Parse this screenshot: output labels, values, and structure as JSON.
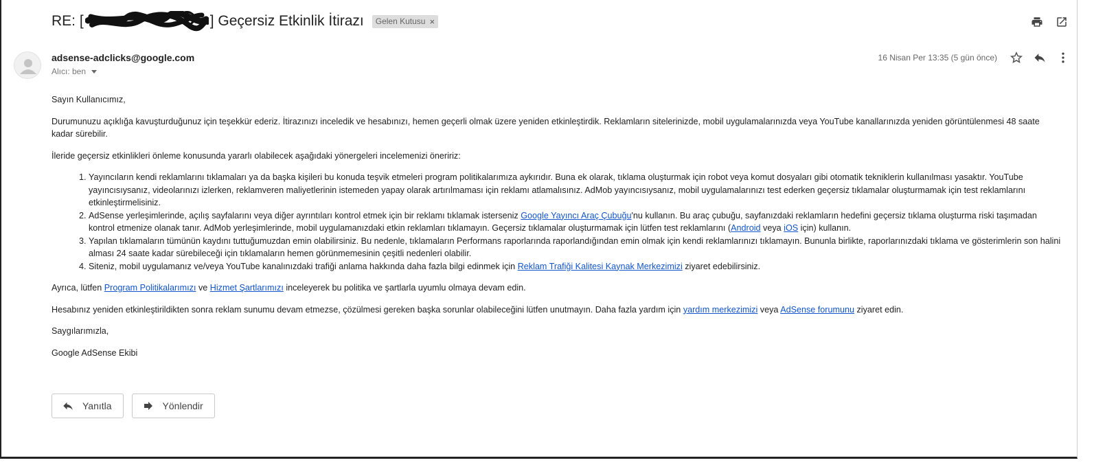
{
  "subject": {
    "prefix": "RE: [",
    "suffix": "] Geçersiz Etkinlik İtirazı",
    "label": "Gelen Kutusu",
    "label_close": "×"
  },
  "sender": {
    "email": "adsense-adclicks@google.com",
    "to": "Alıcı: ben",
    "date": "16 Nisan Per 13:35 (5 gün önce)"
  },
  "message": {
    "greeting": "Sayın Kullanıcımız,",
    "p1": "Durumunuzu açıklığa kavuşturduğunuz için teşekkür ederiz. İtirazınızı inceledik ve hesabınızı, hemen geçerli olmak üzere yeniden etkinleştirdik. Reklamların sitelerinizde, mobil uygulamalarınızda veya YouTube kanallarınızda yeniden görüntülenmesi 48 saate kadar sürebilir.",
    "p2": "İleride geçersiz etkinlikleri önleme konusunda yararlı olabilecek aşağıdaki yönergeleri incelemenizi öneririz:",
    "li1": "Yayıncıların kendi reklamlarını tıklamaları ya da başka kişileri bu konuda teşvik etmeleri program politikalarımıza aykırıdır. Buna ek olarak, tıklama oluşturmak için robot veya komut dosyaları gibi otomatik tekniklerin kullanılması yasaktır. YouTube yayıncısıysanız, videolarınızı izlerken, reklamveren maliyetlerinin istemeden yapay olarak artırılmaması için reklamı atlamalısınız. AdMob yayıncısıysanız, mobil uygulamalarınızı test ederken geçersiz tıklamalar oluşturmamak için test reklamlarını etkinleştirmelisiniz.",
    "li2_a": "AdSense yerleşimlerinde, açılış sayfalarını veya diğer ayrıntıları kontrol etmek için bir reklamı tıklamak isterseniz ",
    "li2_link1": "Google Yayıncı Araç Çubuğu",
    "li2_b": "'nu kullanın. Bu araç çubuğu, sayfanızdaki reklamların hedefini geçersiz tıklama oluşturma riski taşımadan kontrol etmenize olanak tanır. AdMob yerleşimlerinde, mobil uygulamanızdaki etkin reklamları tıklamayın. Geçersiz tıklamalar oluşturmamak için lütfen test reklamlarını (",
    "li2_link2": "Android",
    "li2_c": " veya ",
    "li2_link3": "iOS",
    "li2_d": " için) kullanın.",
    "li3": "Yapılan tıklamaların tümünün kaydını tuttuğumuzdan emin olabilirsiniz. Bu nedenle, tıklamaların Performans raporlarında raporlandığından emin olmak için kendi reklamlarınızı tıklamayın. Bununla birlikte, raporlarınızdaki tıklama ve gösterimlerin son halini alması 24 saate kadar sürebileceği için tıklamaların hemen görünmemesinin çeşitli nedenleri olabilir.",
    "li4_a": "Siteniz, mobil uygulamanız ve/veya YouTube kanalınızdaki trafiği anlama hakkında daha fazla bilgi edinmek için ",
    "li4_link": "Reklam Trafiği Kalitesi Kaynak Merkezimizi",
    "li4_b": " ziyaret edebilirsiniz.",
    "p3_a": "Ayrıca, lütfen ",
    "p3_link1": "Program Politikalarımızı",
    "p3_b": " ve ",
    "p3_link2": "Hizmet Şartlarımızı",
    "p3_c": " inceleyerek bu politika ve şartlarla uyumlu olmaya devam edin.",
    "p4_a": "Hesabınız yeniden etkinleştirildikten sonra reklam sunumu devam etmezse, çözülmesi gereken başka sorunlar olabileceğini lütfen unutmayın. Daha fazla yardım için ",
    "p4_link1": "yardım merkezimizi",
    "p4_b": " veya ",
    "p4_link2": "AdSense forumunu",
    "p4_c": " ziyaret edin.",
    "closing": "Saygılarımızla,",
    "signature": "Google AdSense Ekibi"
  },
  "actions": {
    "reply": "Yanıtla",
    "forward": "Yönlendir"
  },
  "icons": {
    "print": "print-icon",
    "open_new": "open-in-new-window-icon",
    "star": "star-icon",
    "reply": "reply-icon",
    "more": "more-vertical-icon",
    "forward": "forward-icon",
    "avatar": "person-avatar-icon"
  }
}
